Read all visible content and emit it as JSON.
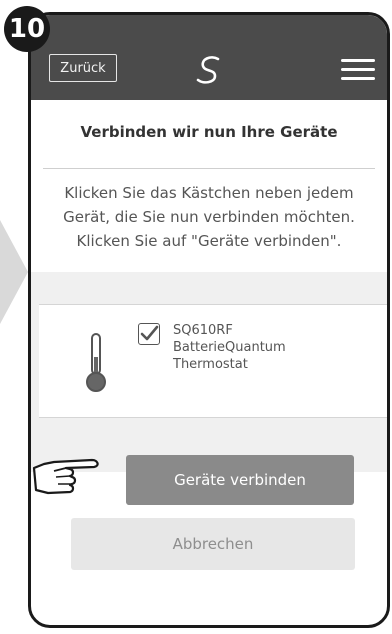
{
  "step": {
    "number": "10"
  },
  "header": {
    "back_label": "Zurück",
    "logo_icon": "salus-logo-icon",
    "menu_icon": "hamburger-menu-icon"
  },
  "page": {
    "title": "Verbinden wir nun Ihre Geräte",
    "instructions": [
      "Klicken Sie das Kästchen neben jedem",
      "Gerät, die Sie nun verbinden möchten.",
      "Klicken Sie auf \"Geräte verbinden\"."
    ]
  },
  "device": {
    "icon": "thermometer-icon",
    "checked": true,
    "model": "SQ610RF",
    "line2": "BatterieQuantum",
    "line3": "Thermostat"
  },
  "buttons": {
    "connect_label": "Geräte verbinden",
    "cancel_label": "Abbrechen"
  },
  "colors": {
    "header": "#4b4b4b",
    "primary_button": "#8a8a8a",
    "secondary_button": "#e7e7e7"
  }
}
